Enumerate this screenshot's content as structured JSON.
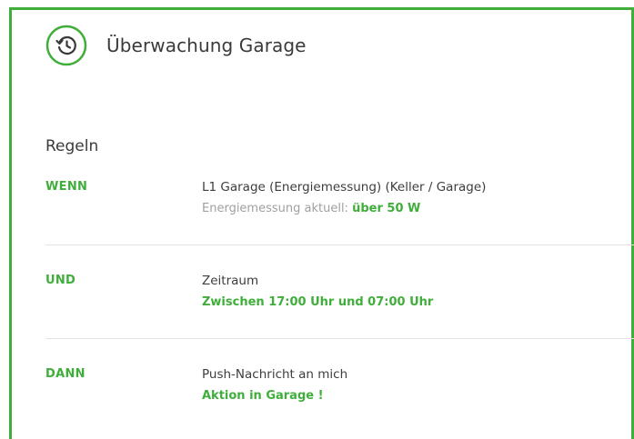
{
  "header": {
    "icon": "history-icon",
    "title": "Überwachung Garage"
  },
  "colors": {
    "accent": "#3fae3a",
    "text": "#3a3a3a",
    "muted": "#a0a0a0",
    "divider": "#e3e3e3"
  },
  "rules": {
    "section_title": "Regeln",
    "items": [
      {
        "keyword": "WENN",
        "main": "L1 Garage (Energiemessung)  (Keller / Garage)",
        "sub_prefix": "Energiemessung aktuell: ",
        "sub_value": "über 50 W"
      },
      {
        "keyword": "UND",
        "main": "Zeitraum",
        "sub_prefix": "",
        "sub_value": "Zwischen 17:00 Uhr und 07:00 Uhr"
      },
      {
        "keyword": "DANN",
        "main": "Push-Nachricht an mich",
        "sub_prefix": "",
        "sub_value": "Aktion in Garage !"
      }
    ]
  }
}
